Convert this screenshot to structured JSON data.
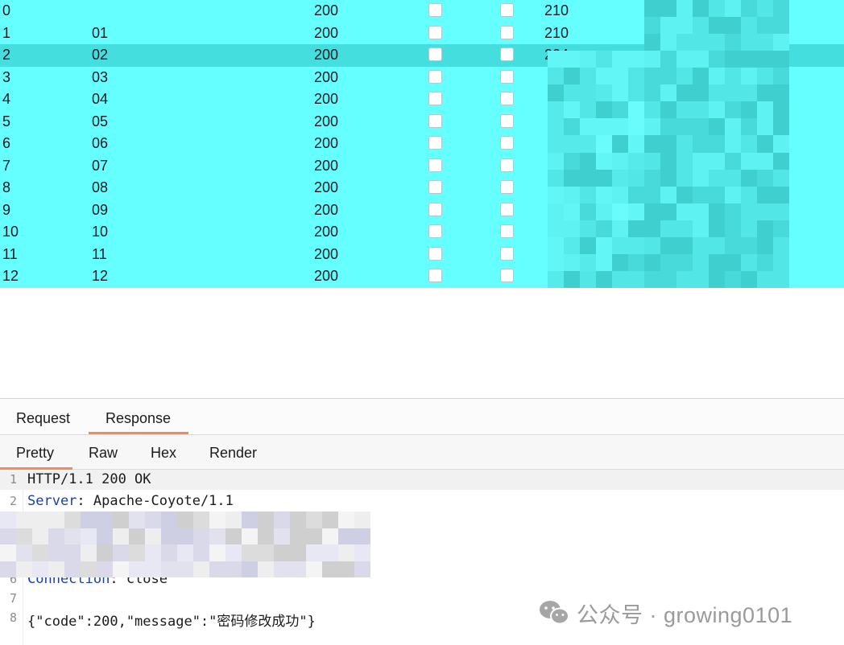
{
  "results": {
    "rows": [
      {
        "index": "0",
        "payload": "",
        "status": "200",
        "length": "210",
        "selected": false
      },
      {
        "index": "1",
        "payload": "01",
        "status": "200",
        "length": "210",
        "selected": false
      },
      {
        "index": "2",
        "payload": "02",
        "status": "200",
        "length": "204",
        "selected": true
      },
      {
        "index": "3",
        "payload": "03",
        "status": "200",
        "length": "",
        "selected": false
      },
      {
        "index": "4",
        "payload": "04",
        "status": "200",
        "length": "",
        "selected": false
      },
      {
        "index": "5",
        "payload": "05",
        "status": "200",
        "length": "",
        "selected": false
      },
      {
        "index": "6",
        "payload": "06",
        "status": "200",
        "length": "",
        "selected": false
      },
      {
        "index": "7",
        "payload": "07",
        "status": "200",
        "length": "",
        "selected": false
      },
      {
        "index": "8",
        "payload": "08",
        "status": "200",
        "length": "",
        "selected": false
      },
      {
        "index": "9",
        "payload": "09",
        "status": "200",
        "length": "",
        "selected": false
      },
      {
        "index": "10",
        "payload": "10",
        "status": "200",
        "length": "",
        "selected": false
      },
      {
        "index": "11",
        "payload": "11",
        "status": "200",
        "length": "",
        "selected": false
      },
      {
        "index": "12",
        "payload": "12",
        "status": "200",
        "length": "",
        "selected": false
      }
    ],
    "colors": {
      "row_bg": "#66ffff",
      "selected_bg": "#44dede"
    }
  },
  "editor": {
    "tabs": {
      "request": "Request",
      "response": "Response",
      "active": "Response"
    },
    "subtabs": {
      "pretty": "Pretty",
      "raw": "Raw",
      "hex": "Hex",
      "render": "Render",
      "active": "Pretty"
    },
    "lines": [
      {
        "n": "1",
        "text": "HTTP/1.1 200 OK"
      },
      {
        "n": "2",
        "key": "Server",
        "value": ": Apache-Coyote/1.1"
      },
      {
        "n": "6",
        "key": "Connection",
        "value": ": close"
      },
      {
        "n": "7",
        "text": ""
      },
      {
        "n": "8",
        "text": "{\"code\":200,\"message\":\"密码修改成功\"}"
      }
    ],
    "accent": "#f08a57"
  },
  "watermark": {
    "text": "公众号 · growing0101",
    "icon": "wechat-icon"
  }
}
